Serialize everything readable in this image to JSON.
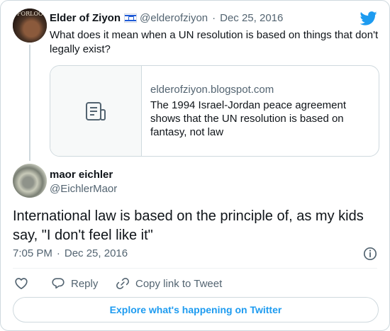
{
  "parent_tweet": {
    "avatar_text": "FORLOOK",
    "author_name": "Elder of Ziyon",
    "author_handle": "@elderofziyon",
    "separator": "·",
    "date": "Dec 25, 2016",
    "text": "What does it mean when a UN resolution is based on things that don't legally exist?",
    "link_card": {
      "domain": "elderofziyon.blogspot.com",
      "description": "The 1994 Israel-Jordan peace agreement shows that the UN resolution is based on fantasy, not law"
    }
  },
  "main_tweet": {
    "author_name": "maor eichler",
    "author_handle": "@EichlerMaor",
    "text": "International law is based on the principle of, as my kids say, \"I don't feel like it\"",
    "time": "7:05 PM",
    "separator": "·",
    "date": "Dec 25, 2016"
  },
  "actions": {
    "reply_label": "Reply",
    "copy_link_label": "Copy link to Tweet"
  },
  "footer": {
    "explore_label": "Explore what's happening on Twitter"
  },
  "icons": {
    "brand": "twitter-bird-icon",
    "flag": "israel-flag-icon",
    "document": "document-icon",
    "info": "info-icon",
    "like": "heart-icon",
    "reply": "reply-icon",
    "copy_link": "link-icon"
  },
  "colors": {
    "brand": "#1d9bf0",
    "text": "#0f1419",
    "muted": "#536471",
    "border": "#cfd9de"
  }
}
